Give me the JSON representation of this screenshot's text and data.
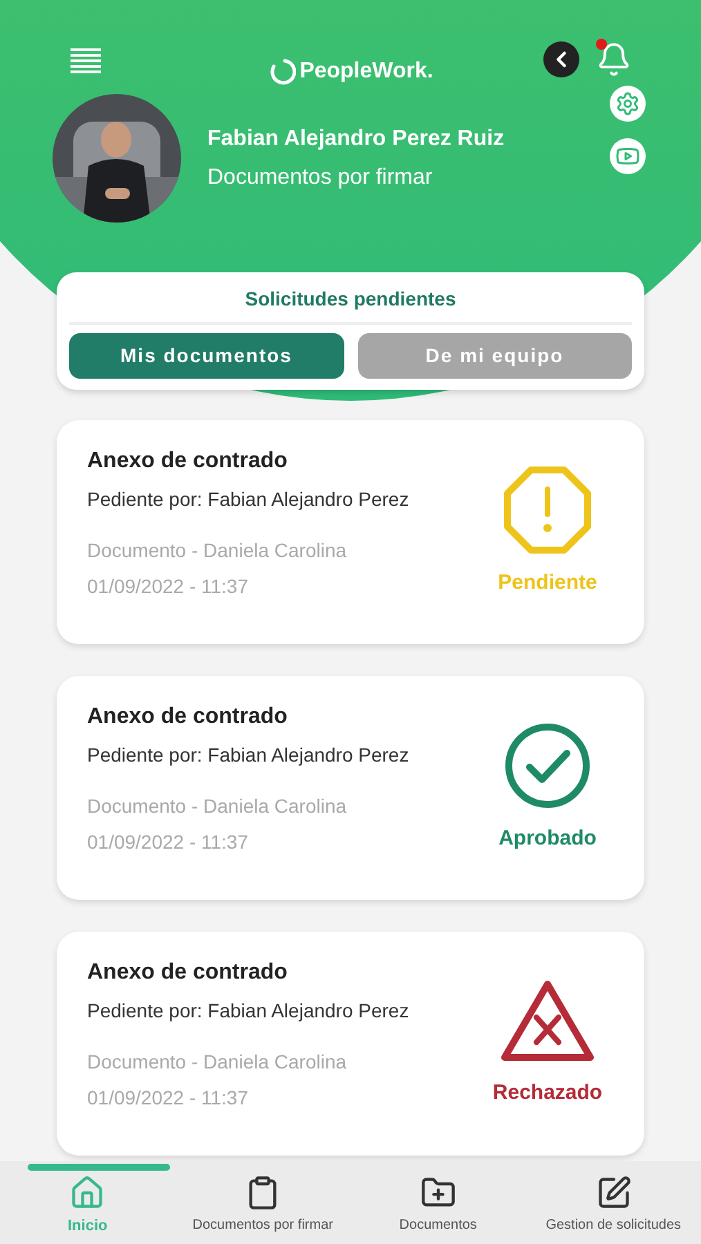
{
  "header": {
    "logo": "PeopleWork.",
    "notification": true,
    "user_name": "Fabian Alejandro Perez Ruiz",
    "subtitle": "Documentos por firmar"
  },
  "requests_panel": {
    "title": "Solicitudes pendientes",
    "tabs": [
      {
        "label": "Mis documentos",
        "selected": true
      },
      {
        "label": "De mi equipo",
        "selected": false
      }
    ]
  },
  "cards": [
    {
      "title": "Anexo de contrado",
      "pending_by": "Pediente por: Fabian Alejandro Perez",
      "document": "Documento - Daniela Carolina",
      "date": "01/09/2022 - 11:37",
      "kind": "pending",
      "status": "Pendiente"
    },
    {
      "title": "Anexo de contrado",
      "pending_by": "Pediente por: Fabian Alejandro Perez",
      "document": "Documento - Daniela Carolina",
      "date": "01/09/2022 - 11:37",
      "kind": "approved",
      "status": "Aprobado"
    },
    {
      "title": "Anexo de contrado",
      "pending_by": "Pediente por: Fabian Alejandro Perez",
      "document": "Documento - Daniela Carolina",
      "date": "01/09/2022 - 11:37",
      "kind": "rejected",
      "status": "Rechazado"
    }
  ],
  "nav": [
    {
      "label": "Inicio",
      "kind": "home",
      "selected": true
    },
    {
      "label": "Documentos por firmar",
      "kind": "clipboard",
      "selected": false
    },
    {
      "label": "Documentos",
      "kind": "folder",
      "selected": false
    },
    {
      "label": "Gestion de solicitudes",
      "kind": "edit",
      "selected": false
    }
  ]
}
